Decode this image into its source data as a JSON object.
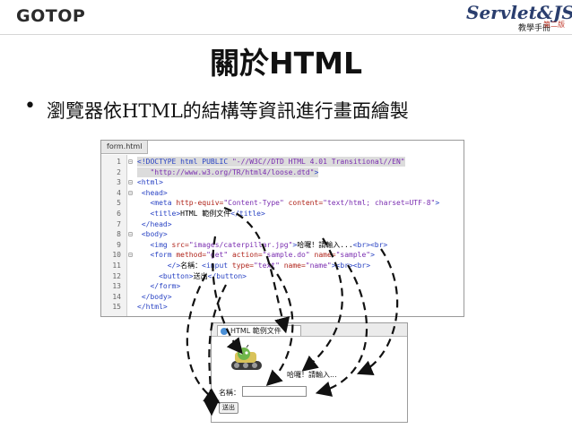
{
  "header": {
    "left_logo": "GOTOP",
    "right_logo_title": "Servlet&JSP",
    "right_logo_subtitle": "教學手冊",
    "right_logo_edition": "第二版"
  },
  "slide": {
    "title": "關於HTML",
    "bullet": "瀏覽器依HTML的結構等資訊進行畫面繪製"
  },
  "editor": {
    "tab": "form.html",
    "lines": [
      {
        "n": "1",
        "fold": "⊟",
        "html": "<span class='tag'>&lt;!DOCTYPE html PUBLIC </span><span class='val'>\"-//W3C//DTD HTML 4.01 Transitional//EN\"</span>"
      },
      {
        "n": "2",
        "fold": "",
        "html": "   <span class='val'>\"http://www.w3.org/TR/html4/loose.dtd\"</span><span class='tag'>&gt;</span>"
      },
      {
        "n": "3",
        "fold": "⊟",
        "html": "<span class='tag'>&lt;html&gt;</span>"
      },
      {
        "n": "4",
        "fold": "⊟",
        "html": " <span class='tag'>&lt;head&gt;</span>"
      },
      {
        "n": "5",
        "fold": "",
        "html": "   <span class='tag'>&lt;meta </span><span class='attr'>http-equiv=</span><span class='val'>\"Content-Type\"</span><span class='attr'> content=</span><span class='val'>\"text/html; charset=UTF-8\"</span><span class='tag'>&gt;</span>"
      },
      {
        "n": "6",
        "fold": "",
        "html": "   <span class='tag'>&lt;title&gt;</span><span class='plain'>HTML 範例文件</span><span class='tag'>&lt;/title&gt;</span>"
      },
      {
        "n": "7",
        "fold": "",
        "html": " <span class='tag'>&lt;/head&gt;</span>"
      },
      {
        "n": "8",
        "fold": "⊟",
        "html": " <span class='tag'>&lt;body&gt;</span>"
      },
      {
        "n": "9",
        "fold": "",
        "html": "   <span class='tag'>&lt;img </span><span class='attr'>src=</span><span class='val'>\"images/caterpillar.jpg\"</span><span class='tag'>&gt;</span><span class='plain'>哈囉！請輸入...</span><span class='tag'>&lt;br&gt;&lt;br&gt;</span>"
      },
      {
        "n": "10",
        "fold": "⊟",
        "html": "   <span class='tag'>&lt;form </span><span class='attr'>method=</span><span class='val'>\"get\"</span><span class='attr'> action=</span><span class='val'>\"sample.do\"</span><span class='attr'> name=</span><span class='val'>\"sample\"</span><span class='tag'>&gt;</span>"
      },
      {
        "n": "11",
        "fold": "",
        "html": "       <span class='tag'>&lt;/&gt;</span><span class='plain'>名稱：</span><span class='tag'>&lt;input </span><span class='attr'>type=</span><span class='val'>\"text\"</span><span class='attr'> name=</span><span class='val'>\"name\"</span><span class='tag'>&gt;&lt;br&gt;&lt;br&gt;</span>"
      },
      {
        "n": "12",
        "fold": "",
        "html": "     <span class='tag'>&lt;button&gt;</span><span class='plain'>送出</span><span class='tag'>&lt;/button&gt;</span>"
      },
      {
        "n": "13",
        "fold": "",
        "html": "   <span class='tag'>&lt;/form&gt;</span>"
      },
      {
        "n": "14",
        "fold": "",
        "html": " <span class='tag'>&lt;/body&gt;</span>"
      },
      {
        "n": "15",
        "fold": "",
        "html": "<span class='tag'>&lt;/html&gt;</span>"
      }
    ]
  },
  "browser": {
    "tab": "HTML 範例文件",
    "welcome": "哈囉！請輸入...",
    "name_label": "名稱：",
    "name_value": "",
    "submit": "送出"
  },
  "colors": {
    "tag": "#2a44c4",
    "attr": "#b0241b",
    "value": "#7a2db0",
    "arrow": "#111111"
  }
}
